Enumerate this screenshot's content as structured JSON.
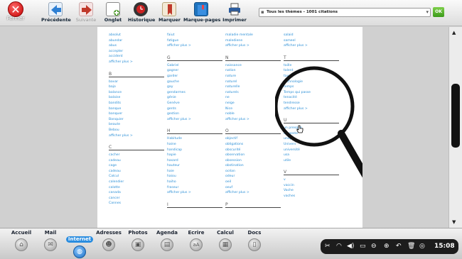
{
  "toolbar": {
    "close_label": "Fermer",
    "buttons": [
      {
        "label": "Précédente",
        "icon": "back-arrow-icon",
        "color": "#2d7fd3"
      },
      {
        "label": "Suivante",
        "icon": "forward-arrow-icon",
        "color": "#c0392b"
      },
      {
        "label": "Onglet",
        "icon": "new-tab-icon",
        "color": "#4e9a2c"
      },
      {
        "label": "Historique",
        "icon": "history-clock-icon",
        "color": "#b22"
      },
      {
        "label": "Marquer",
        "icon": "bookmark-icon",
        "color": "#c0392b"
      },
      {
        "label": "Marque-pages",
        "icon": "bookmarks-book-icon",
        "color": "#1e73be"
      },
      {
        "label": "Imprimer",
        "icon": "printer-icon",
        "color": "#2b5c9e"
      }
    ],
    "search_value": "Tous les thèmes - 1001 citations",
    "ok_label": "OK"
  },
  "themes": {
    "col1": [
      {
        "letter": "",
        "items": [
          "absolut",
          "abundar",
          "abus",
          "accepter",
          "accident",
          "afficher plus >"
        ]
      },
      {
        "letter": "B",
        "items": [
          "bavar",
          "bajo",
          "balance",
          "balaise",
          "bandits",
          "banque",
          "banquer",
          "Banquier",
          "beaute",
          "Bebou",
          "afficher plus >"
        ]
      },
      {
        "letter": "C",
        "items": [
          "cacher",
          "cadeau",
          "cage",
          "cadeau",
          "Calcul",
          "calendier",
          "calotte",
          "canada",
          "cancer",
          "Cannes"
        ]
      }
    ],
    "col2": [
      {
        "letter": "",
        "items": [
          "faiut",
          "fatigue",
          "afficher plus >"
        ]
      },
      {
        "letter": "G",
        "items": [
          "Gabriel",
          "gagner",
          "garder",
          "gauche",
          "gay",
          "gendarmes",
          "génie",
          "Genève",
          "gents",
          "gestion",
          "afficher plus >"
        ]
      },
      {
        "letter": "H",
        "items": [
          "Habitude",
          "haine",
          "handicap",
          "hapie",
          "hasard",
          "hauteur",
          "haie",
          "haiou",
          "haiho",
          "fraseur",
          "afficher plus >"
        ]
      },
      {
        "letter": "I",
        "items": []
      }
    ],
    "col3": [
      {
        "letter": "",
        "items": [
          "maladie mentale",
          "malediene",
          "afficher plus >"
        ]
      },
      {
        "letter": "N",
        "items": [
          "naissance",
          "nation",
          "nature",
          "naturel",
          "naturelle",
          "naturels",
          "ne",
          "neige",
          "Nice",
          "noble",
          "afficher plus >"
        ]
      },
      {
        "letter": "O",
        "items": [
          "objectif",
          "obligations",
          "obscurité",
          "observation",
          "obsession",
          "obstination",
          "océan",
          "odeur",
          "oeil",
          "oeuf",
          "afficher plus >"
        ]
      },
      {
        "letter": "P",
        "items": []
      }
    ],
    "col4": [
      {
        "letter": "",
        "items": [
          "salaid",
          "sameel",
          "afficher plus >"
        ]
      },
      {
        "letter": "T",
        "items": [
          "taille",
          "talent",
          "taxi",
          "technologie",
          "temps",
          "Temps qui passe",
          "tenacité",
          "tendresse",
          "afficher plus >"
        ]
      },
      {
        "letter": "U",
        "items": [
          "un presque",
          "un geste",
          "unique",
          "Univers",
          "université",
          "usa",
          "utile"
        ]
      },
      {
        "letter": "V",
        "items": [
          "v",
          "vaccin",
          "Vache",
          "vaches"
        ]
      }
    ]
  },
  "dock": {
    "items": [
      {
        "label": "Accueil",
        "icon": "home-icon"
      },
      {
        "label": "Mail",
        "icon": "mail-icon"
      },
      {
        "label": "Internet",
        "icon": "globe-icon"
      },
      {
        "label": "Adresses",
        "icon": "contacts-icon"
      },
      {
        "label": "Photos",
        "icon": "photos-icon"
      },
      {
        "label": "Agenda",
        "icon": "calendar-icon"
      },
      {
        "label": "Ecrire",
        "icon": "write-icon"
      },
      {
        "label": "Calcul",
        "icon": "calculator-icon"
      },
      {
        "label": "Docs",
        "icon": "docs-icon"
      }
    ],
    "active": "Internet"
  },
  "tray": {
    "time": "15:08"
  }
}
